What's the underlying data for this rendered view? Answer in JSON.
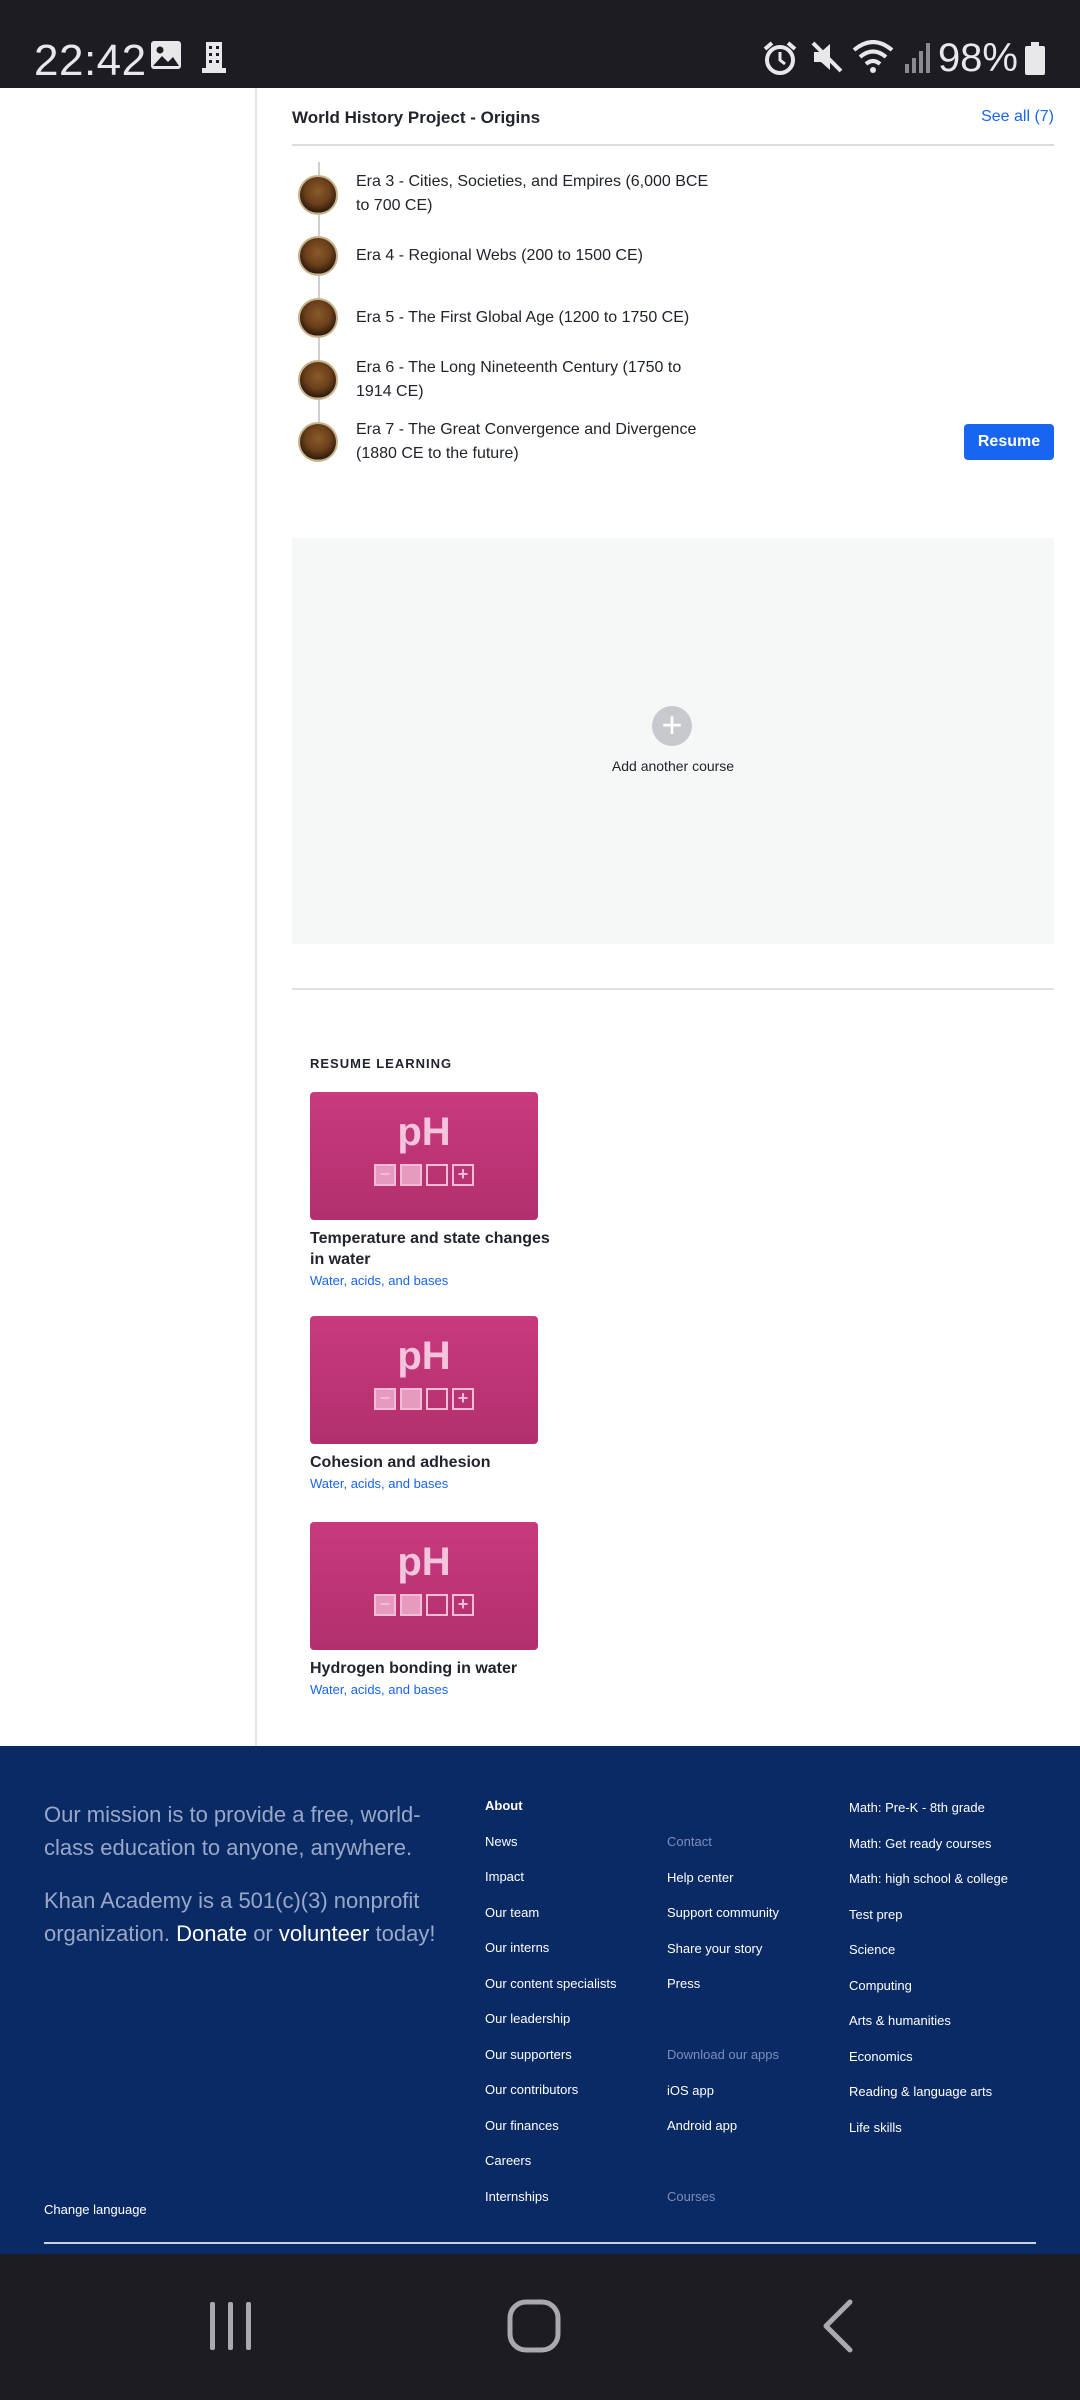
{
  "status": {
    "time": "22:42",
    "battery": "98%",
    "icons": [
      "image-icon",
      "building-icon",
      "alarm-icon",
      "mute-icon",
      "wifi-icon",
      "signal-icon",
      "battery-icon"
    ]
  },
  "course": {
    "title": "World History Project - Origins",
    "see_all": "See all (7)",
    "eras": [
      {
        "label": "Era 3 - Cities, Societies, and Empires (6,000 BCE to 700 CE)"
      },
      {
        "label": "Era 4 - Regional Webs (200 to 1500 CE)"
      },
      {
        "label": "Era 5 - The First Global Age (1200 to 1750 CE)"
      },
      {
        "label": "Era 6 - The Long Nineteenth Century (1750 to 1914 CE)"
      },
      {
        "label": "Era 7 - The Great Convergence and Divergence (1880 CE to the future)"
      }
    ],
    "resume_label": "Resume"
  },
  "add_course": {
    "label": "Add another course"
  },
  "resume_learning": {
    "heading": "RESUME LEARNING",
    "cards": [
      {
        "tile_text": "pH",
        "title": "Temperature and state changes in water",
        "subtitle": "Water, acids, and bases"
      },
      {
        "tile_text": "pH",
        "title": "Cohesion and adhesion",
        "subtitle": "Water, acids, and bases"
      },
      {
        "tile_text": "pH",
        "title": "Hydrogen bonding in water",
        "subtitle": "Water, acids, and bases"
      }
    ]
  },
  "footer": {
    "mission": "Our mission is to provide a free, world-class education to anyone, anywhere.",
    "nonprofit_pre": "Khan Academy is a 501(c)(3) nonprofit organization.",
    "donate": "Donate",
    "or": "or",
    "volunteer": "volunteer",
    "today": "today!",
    "about": {
      "heading": "About",
      "links": [
        "News",
        "Impact",
        "Our team",
        "Our interns",
        "Our content specialists",
        "Our leadership",
        "Our supporters",
        "Our contributors",
        "Our finances",
        "Careers",
        "Internships"
      ]
    },
    "contact": {
      "heading": "Contact",
      "links": [
        "Help center",
        "Support community",
        "Share your story",
        "Press"
      ]
    },
    "apps": {
      "heading": "Download our apps",
      "links": [
        "iOS app",
        "Android app"
      ]
    },
    "courses_heading": "Courses",
    "subjects": [
      "Math: Pre-K - 8th grade",
      "Math: Get ready courses",
      "Math: high school & college",
      "Test prep",
      "Science",
      "Computing",
      "Arts & humanities",
      "Economics",
      "Reading & language arts",
      "Life skills"
    ],
    "change_language": "Change language"
  },
  "navbar": {
    "icons": [
      "recent-apps-icon",
      "home-icon",
      "back-icon"
    ]
  }
}
